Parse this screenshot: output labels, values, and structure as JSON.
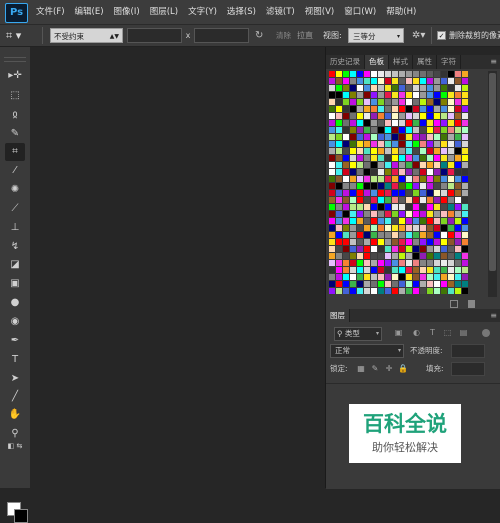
{
  "app": {
    "logo": "Ps"
  },
  "menu": [
    "文件(F)",
    "编辑(E)",
    "图像(I)",
    "图层(L)",
    "文字(Y)",
    "选择(S)",
    "滤镜(T)",
    "视图(V)",
    "窗口(W)",
    "帮助(H)"
  ],
  "options": {
    "ratio_value": "不受约束",
    "x_separator": "x",
    "clear_label": "清除",
    "straighten_label": "拉直",
    "view_label": "视图:",
    "view_value": "三等分",
    "delete_cropped_label": "删除裁剪的像素",
    "delete_cropped_checked": true
  },
  "tools": [
    "move-tool",
    "marquee-tool",
    "lasso-tool",
    "quick-selection-tool",
    "crop-tool",
    "eyedropper-tool",
    "spot-healing-tool",
    "brush-tool",
    "clone-stamp-tool",
    "history-brush-tool",
    "eraser-tool",
    "gradient-tool",
    "blur-tool",
    "dodge-tool",
    "pen-tool",
    "type-tool",
    "path-selection-tool",
    "line-tool",
    "hand-tool",
    "zoom-tool"
  ],
  "active_tool": "crop-tool",
  "colors": {
    "foreground": "#ffffff",
    "background": "#000000"
  },
  "swatches_panel": {
    "tabs": [
      "历史记录",
      "色板",
      "样式",
      "属性",
      "字符"
    ],
    "active_tab": "色板",
    "swatch_colors": [
      "#ff0000",
      "#ffff00",
      "#00ff00",
      "#00ffff",
      "#0000ff",
      "#ff00ff",
      "#ffffff",
      "#ebebeb",
      "#d6d6d6",
      "#c2c2c2",
      "#adadad",
      "#999999",
      "#858585",
      "#707070",
      "#5c5c5c",
      "#474747",
      "#333333",
      "#000000",
      "#f08080",
      "#f5a623",
      "#f8e71c",
      "#7ed321",
      "#4a90e2",
      "#9013fe",
      "#bd10e0",
      "#50e3c2",
      "#b8e986",
      "#417505",
      "#8b572a",
      "#d0021b",
      "#e6194b",
      "#3cb44b",
      "#ffe119",
      "#4363d8",
      "#f58231",
      "#911eb4",
      "#46f0f0",
      "#f032e6",
      "#bcf60c",
      "#fabebe",
      "#008080",
      "#e6beff",
      "#9a6324",
      "#fffac8",
      "#800000",
      "#aaffc3",
      "#808000",
      "#ffd8b1",
      "#000075",
      "#a9a9a9"
    ]
  },
  "layers_panel": {
    "tab": "图层",
    "kind_label": "类型",
    "blend_mode": "正常",
    "opacity_label": "不透明度:",
    "lock_label": "锁定:",
    "fill_label": "填充:"
  },
  "watermark": {
    "title": "百科全说",
    "subtitle": "助你轻松解决"
  }
}
